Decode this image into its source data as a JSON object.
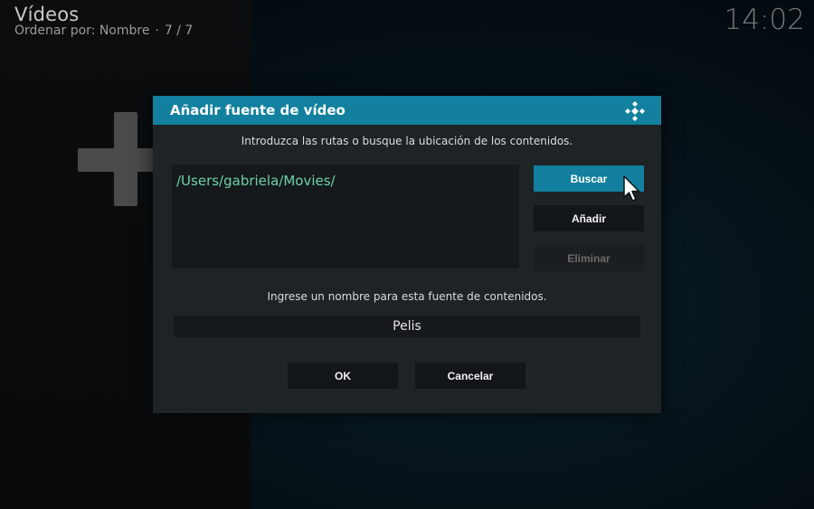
{
  "header": {
    "title": "Vídeos",
    "sort_label": "Ordenar por: Nombre",
    "count": "7 / 7",
    "clock": "14:02"
  },
  "dialog": {
    "title": "Añadir fuente de vídeo",
    "instruction": "Introduzca las rutas o busque la ubicación de los contenidos.",
    "paths": [
      "/Users/gabriela/Movies/"
    ],
    "buttons": {
      "browse": "Buscar",
      "add": "Añadir",
      "remove": "Eliminar"
    },
    "name_prompt": "Ingrese un nombre para esta fuente de contenidos.",
    "name_value": "Pelis",
    "ok": "OK",
    "cancel": "Cancelar"
  },
  "colors": {
    "accent": "#12809e",
    "path_text": "#6fd2a9",
    "dialog_bg": "#1e2326"
  },
  "icons": {
    "logo": "kodi-logo-icon",
    "background_add": "plus-icon",
    "pointer": "mouse-cursor-icon"
  }
}
